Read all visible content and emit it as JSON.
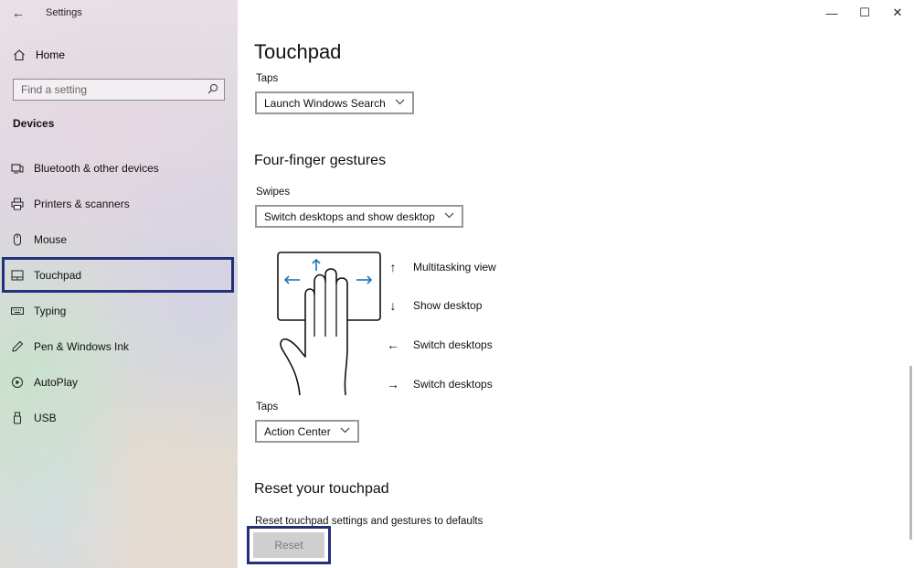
{
  "window": {
    "title": "Settings",
    "back_icon": "←",
    "minimize_icon": "—",
    "maximize_icon": "☐",
    "close_icon": "✕"
  },
  "sidebar": {
    "home_label": "Home",
    "search_placeholder": "Find a setting",
    "section": "Devices",
    "items": [
      {
        "label": "Bluetooth & other devices",
        "icon": "bluetooth-devices-icon"
      },
      {
        "label": "Printers & scanners",
        "icon": "printer-icon"
      },
      {
        "label": "Mouse",
        "icon": "mouse-icon"
      },
      {
        "label": "Touchpad",
        "icon": "touchpad-icon",
        "selected": true
      },
      {
        "label": "Typing",
        "icon": "keyboard-icon"
      },
      {
        "label": "Pen & Windows Ink",
        "icon": "pen-icon"
      },
      {
        "label": "AutoPlay",
        "icon": "autoplay-icon"
      },
      {
        "label": "USB",
        "icon": "usb-icon"
      }
    ]
  },
  "main": {
    "title": "Touchpad",
    "taps_top": {
      "label": "Taps",
      "value": "Launch Windows Search"
    },
    "four_finger": {
      "heading": "Four-finger gestures",
      "swipes_label": "Swipes",
      "swipes_value": "Switch desktops and show desktop",
      "gestures": [
        {
          "arrow": "↑",
          "label": "Multitasking view"
        },
        {
          "arrow": "↓",
          "label": "Show desktop"
        },
        {
          "arrow": "←",
          "label": "Switch desktops"
        },
        {
          "arrow": "→",
          "label": "Switch desktops"
        }
      ],
      "taps_label": "Taps",
      "taps_value": "Action Center"
    },
    "reset": {
      "heading": "Reset your touchpad",
      "description": "Reset touchpad settings and gestures to defaults",
      "button_label": "Reset"
    }
  },
  "colors": {
    "highlight": "#23317a",
    "gesture_arrow": "#1a73b5"
  }
}
